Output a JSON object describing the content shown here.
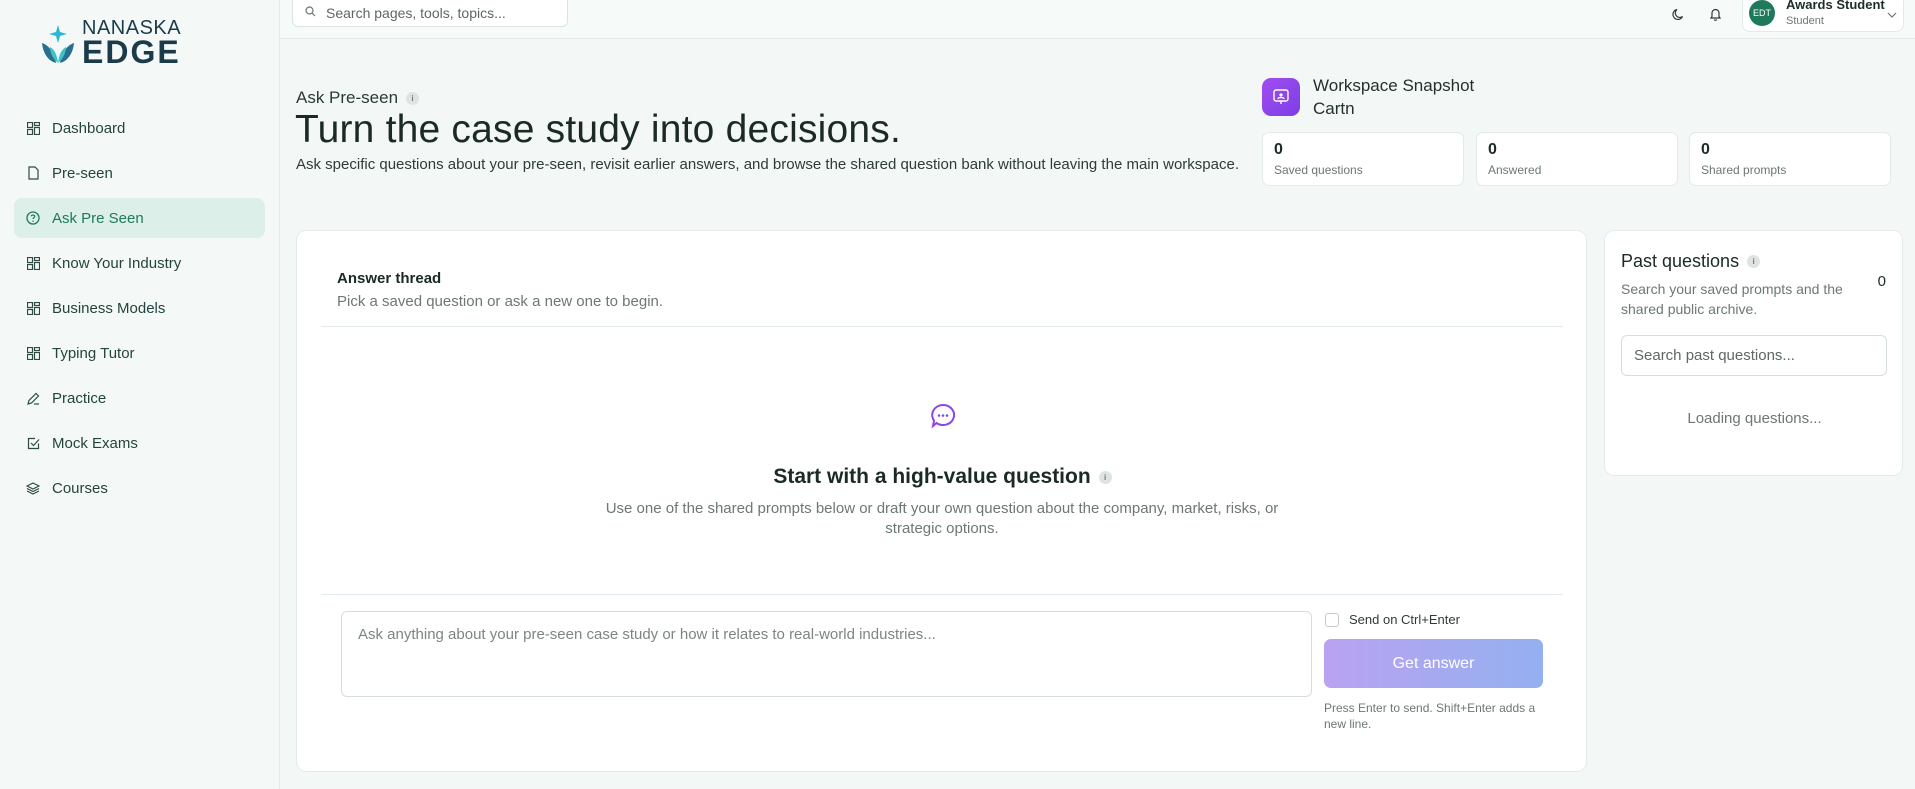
{
  "brand": {
    "top": "NANASKA",
    "bottom": "EDGE"
  },
  "search": {
    "placeholder": "Search pages, tools, topics..."
  },
  "user": {
    "initials": "EDT",
    "name": "Awards Student",
    "role": "Student"
  },
  "sidebar": {
    "items": [
      {
        "label": "Dashboard",
        "icon": "dashboard-icon"
      },
      {
        "label": "Pre-seen",
        "icon": "document-icon"
      },
      {
        "label": "Ask Pre Seen",
        "icon": "help-circle-icon",
        "active": true
      },
      {
        "label": "Know Your Industry",
        "icon": "grid-icon"
      },
      {
        "label": "Business Models",
        "icon": "grid-icon"
      },
      {
        "label": "Typing Tutor",
        "icon": "grid-icon"
      },
      {
        "label": "Practice",
        "icon": "pencil-icon"
      },
      {
        "label": "Mock Exams",
        "icon": "checkbox-icon"
      },
      {
        "label": "Courses",
        "icon": "layers-icon"
      }
    ]
  },
  "header": {
    "eyebrow": "Ask Pre-seen",
    "info": "i",
    "title": "Turn the case study into decisions.",
    "subtitle": "Ask specific questions about your pre-seen, revisit earlier answers, and browse the shared question bank without leaving the main workspace."
  },
  "snapshot": {
    "title": "Workspace Snapshot",
    "subtitle": "Cartn",
    "stats": [
      {
        "value": "0",
        "label": "Saved questions"
      },
      {
        "value": "0",
        "label": "Answered"
      },
      {
        "value": "0",
        "label": "Shared prompts"
      }
    ]
  },
  "thread": {
    "title": "Answer thread",
    "subtitle": "Pick a saved question or ask a new one to begin.",
    "empty_title": "Start with a high-value question",
    "empty_sub": "Use one of the shared prompts below or draft your own question about the company, market, risks, or strategic options.",
    "input_placeholder": "Ask anything about your pre-seen case study or how it relates to real-world industries...",
    "send_toggle": "Send on Ctrl+Enter",
    "button": "Get answer",
    "hint": "Press Enter to send. Shift+Enter adds a new line."
  },
  "past": {
    "title": "Past questions",
    "count": "0",
    "subtitle": "Search your saved prompts and the shared public archive.",
    "placeholder": "Search past questions...",
    "loading": "Loading questions..."
  },
  "colors": {
    "accent": "#1f7a5c",
    "active_bg": "#dcefe8",
    "purple": "#8b45ea"
  }
}
